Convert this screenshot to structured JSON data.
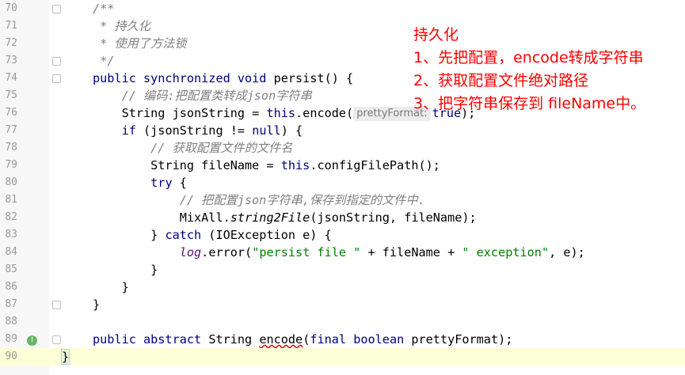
{
  "editor": {
    "lines": [
      {
        "num": "70",
        "tokens": [
          {
            "t": "/**",
            "c": "doc"
          }
        ]
      },
      {
        "num": "71",
        "tokens": [
          {
            "t": " * 持久化",
            "c": "doc"
          }
        ]
      },
      {
        "num": "72",
        "tokens": [
          {
            "t": " * 使用了方法锁",
            "c": "doc"
          }
        ]
      },
      {
        "num": "73",
        "tokens": [
          {
            "t": " */",
            "c": "doc"
          }
        ]
      },
      {
        "num": "74",
        "tokens": [
          {
            "t": "public synchronized void ",
            "c": "kw"
          },
          {
            "t": "persist() {",
            "c": ""
          }
        ]
      },
      {
        "num": "75",
        "tokens": [
          {
            "t": "    // 编码:把配置类转成json字符串",
            "c": "cm"
          }
        ]
      },
      {
        "num": "76",
        "tokens": [
          {
            "t": "    String jsonString = ",
            "c": ""
          },
          {
            "t": "this",
            "c": "kw"
          },
          {
            "t": ".encode(",
            "c": ""
          },
          {
            "t": "prettyFormat:",
            "c": "hint"
          },
          {
            "t": "true",
            "c": "kw"
          },
          {
            "t": ");",
            "c": ""
          }
        ]
      },
      {
        "num": "77",
        "tokens": [
          {
            "t": "    ",
            "c": ""
          },
          {
            "t": "if",
            "c": "kw"
          },
          {
            "t": " (jsonString != ",
            "c": ""
          },
          {
            "t": "null",
            "c": "kw"
          },
          {
            "t": ") {",
            "c": ""
          }
        ]
      },
      {
        "num": "78",
        "tokens": [
          {
            "t": "        // 获取配置文件的文件名",
            "c": "cm"
          }
        ]
      },
      {
        "num": "79",
        "tokens": [
          {
            "t": "        String fileName = ",
            "c": ""
          },
          {
            "t": "this",
            "c": "kw"
          },
          {
            "t": ".configFilePath();",
            "c": ""
          }
        ]
      },
      {
        "num": "80",
        "tokens": [
          {
            "t": "        ",
            "c": ""
          },
          {
            "t": "try",
            "c": "kw"
          },
          {
            "t": " {",
            "c": ""
          }
        ]
      },
      {
        "num": "81",
        "tokens": [
          {
            "t": "            // 把配置json字符串,保存到指定的文件中.",
            "c": "cm"
          }
        ]
      },
      {
        "num": "82",
        "tokens": [
          {
            "t": "            MixAll.",
            "c": ""
          },
          {
            "t": "string2File",
            "c": "static"
          },
          {
            "t": "(jsonString, fileName);",
            "c": ""
          }
        ]
      },
      {
        "num": "83",
        "tokens": [
          {
            "t": "        } ",
            "c": ""
          },
          {
            "t": "catch",
            "c": "kw"
          },
          {
            "t": " (IOException e) {",
            "c": ""
          }
        ]
      },
      {
        "num": "84",
        "tokens": [
          {
            "t": "            ",
            "c": ""
          },
          {
            "t": "log",
            "c": "field"
          },
          {
            "t": ".error(",
            "c": ""
          },
          {
            "t": "\"persist file \"",
            "c": "str"
          },
          {
            "t": " + fileName + ",
            "c": ""
          },
          {
            "t": "\" exception\"",
            "c": "str"
          },
          {
            "t": ", e);",
            "c": ""
          }
        ]
      },
      {
        "num": "85",
        "tokens": [
          {
            "t": "        }",
            "c": ""
          }
        ]
      },
      {
        "num": "86",
        "tokens": [
          {
            "t": "    }",
            "c": ""
          }
        ]
      },
      {
        "num": "87",
        "tokens": [
          {
            "t": "}",
            "c": ""
          }
        ]
      },
      {
        "num": "88",
        "tokens": []
      },
      {
        "num": "89",
        "tokens": [
          {
            "t": "public abstract ",
            "c": "kw"
          },
          {
            "t": "String ",
            "c": ""
          },
          {
            "t": "encode",
            "c": "err"
          },
          {
            "t": "(",
            "c": ""
          },
          {
            "t": "final boolean ",
            "c": "kw"
          },
          {
            "t": "prettyFormat);",
            "c": ""
          }
        ]
      },
      {
        "num": "90",
        "tokens": [
          {
            "t": "}",
            "c": "brace"
          }
        ]
      }
    ]
  },
  "gutter": {
    "implemented_icon": "implementation-marker-icon",
    "implemented_glyph": "I"
  },
  "annotation": {
    "title": "持久化",
    "items": [
      "1、先把配置，encode转成字符串",
      "2、获取配置文件绝对路径",
      "3、把字符串保存到 fileName中。"
    ]
  },
  "colors": {
    "keyword": "#000080",
    "comment": "#808080",
    "string": "#008000",
    "annotation_text": "#ff0000",
    "current_line": "#ffffd7"
  }
}
